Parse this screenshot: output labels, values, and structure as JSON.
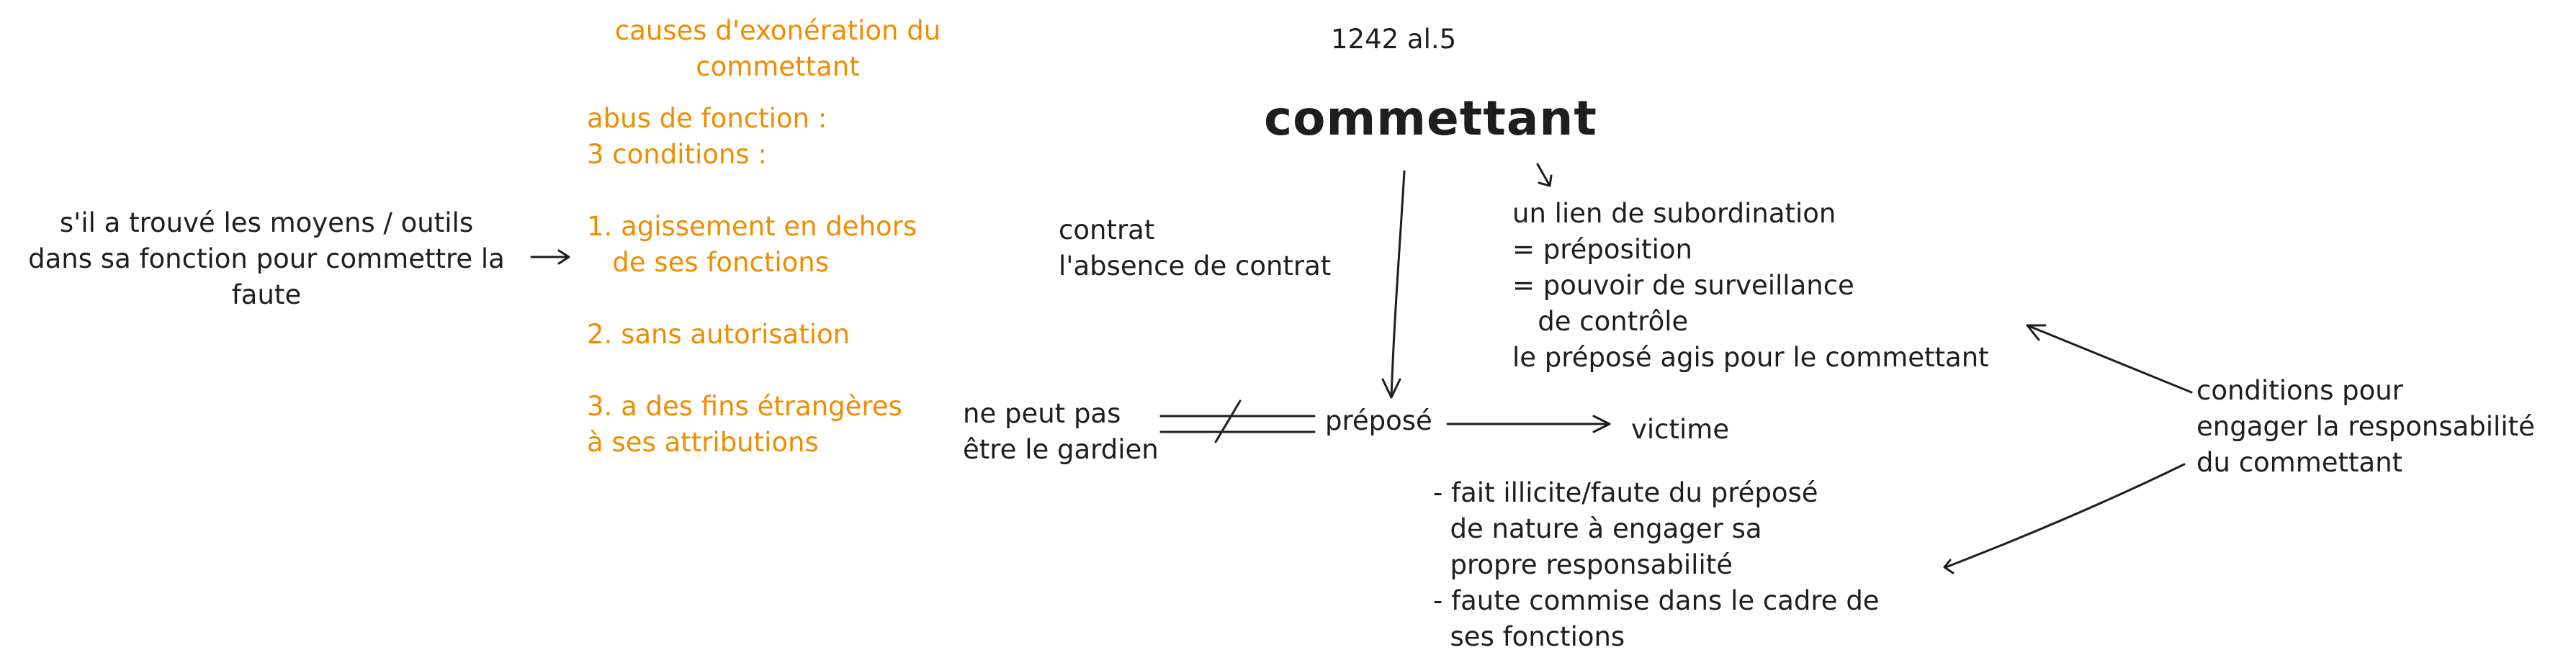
{
  "article_ref": "1242 al.5",
  "main_title": "commettant",
  "exoneration": {
    "header": "causes d'exonération du\ncommettant",
    "intro": "abus de fonction :\n3 conditions :",
    "cond1": "1. agissement en dehors\n   de ses fonctions",
    "cond2": "2. sans autorisation",
    "cond3": "3. a des fins étrangères\nà ses attributions"
  },
  "left_note": "s'il a trouvé les moyens / outils\ndans sa fonction pour commettre la\nfaute",
  "contract_note": "contrat\nl'absence de contrat",
  "subordination": "un lien de subordination\n= préposition\n= pouvoir de surveillance\n   de contrôle\nle préposé agis pour le commettant",
  "gardien_note": "ne peut pas\nêtre le gardien",
  "prepose": "préposé",
  "victime": "victime",
  "faute_conditions": "- fait illicite/faute du préposé\n  de nature à engager sa\n  propre responsabilité\n- faute commise dans le cadre de\n  ses fonctions",
  "conditions_label": "conditions pour\nengager la responsabilité\ndu commettant",
  "colors": {
    "ink": "#1e1e1e",
    "accent": "#f08c00",
    "background": "#ffffff"
  }
}
